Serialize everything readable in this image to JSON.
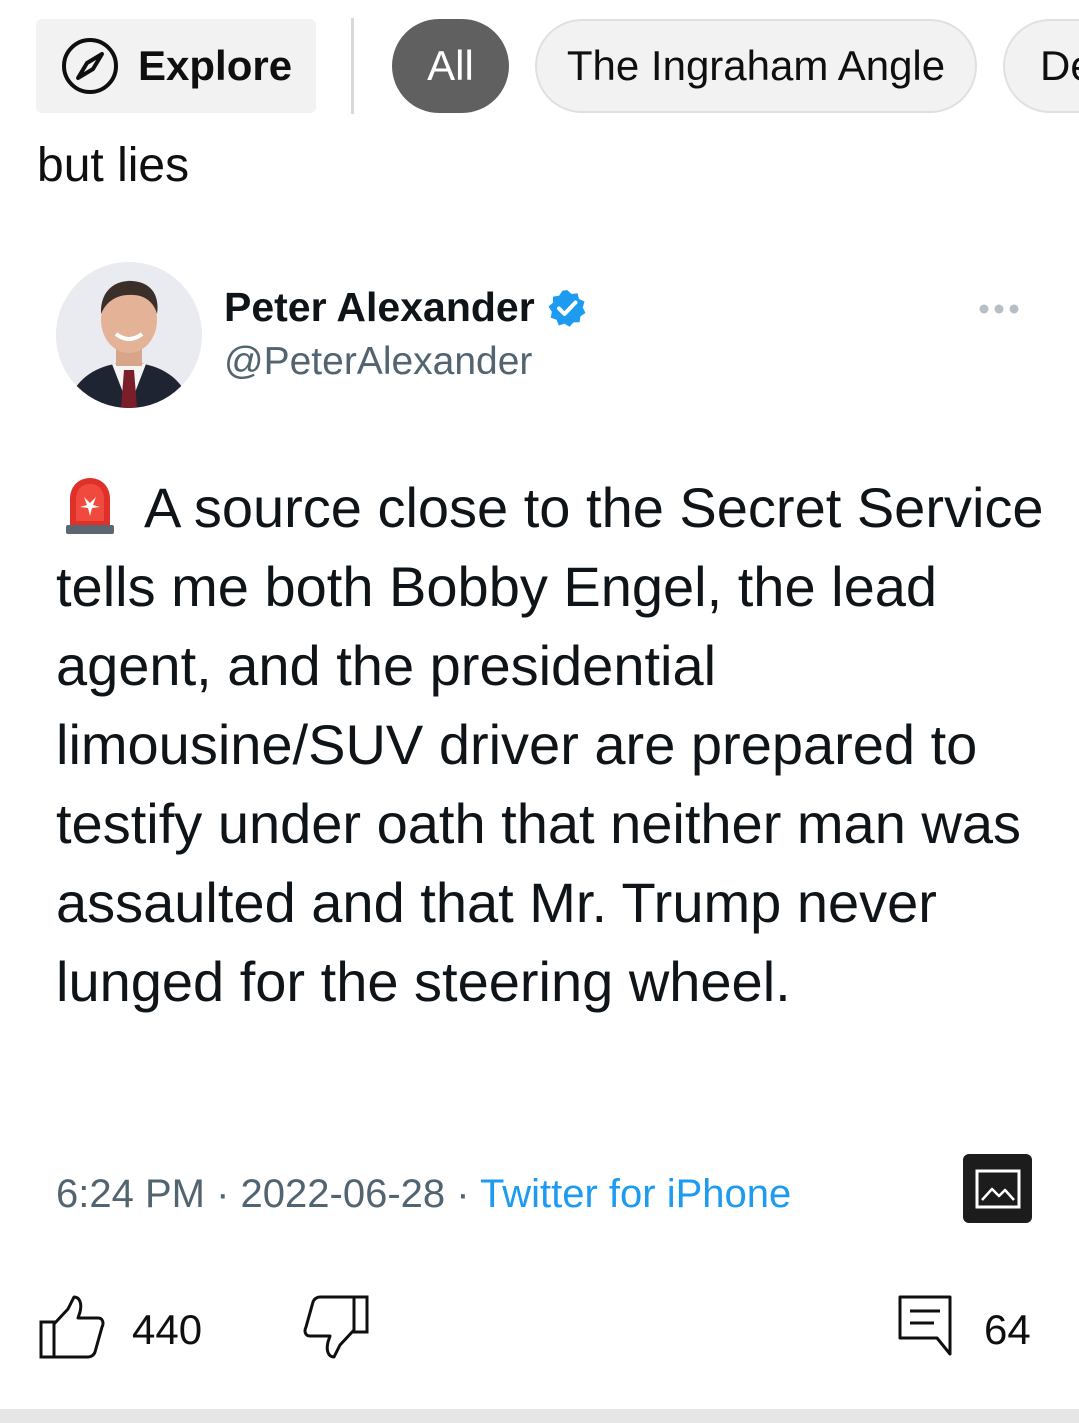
{
  "chips": {
    "explore_label": "Explore",
    "all_label": "All",
    "ingraham_label": "The Ingraham Angle",
    "partial_label": "De"
  },
  "post": {
    "caption": "but lies"
  },
  "tweet": {
    "author_name": "Peter Alexander",
    "author_handle": "@PeterAlexander",
    "text": "A source close to the Secret Service tells me both Bobby Engel, the lead agent, and the presidential limousine/SUV driver are prepared to testify under oath that neither man was assaulted and that Mr. Trump never lunged for the steering wheel.",
    "time": "6:24 PM",
    "date": "2022-06-28",
    "separator": "·",
    "source": "Twitter for iPhone",
    "icons": {
      "emoji": "siren-icon",
      "verified": "verified-badge-icon",
      "more": "more-horizontal-icon",
      "image_toggle": "image-icon"
    },
    "colors": {
      "verified": "#1d9bf0",
      "source_link": "#1d9bf0",
      "meta_text": "#536471"
    }
  },
  "actions": {
    "like_count": "440",
    "comment_count": "64",
    "icons": {
      "like": "thumbs-up-icon",
      "dislike": "thumbs-down-icon",
      "comment": "comment-icon"
    }
  }
}
